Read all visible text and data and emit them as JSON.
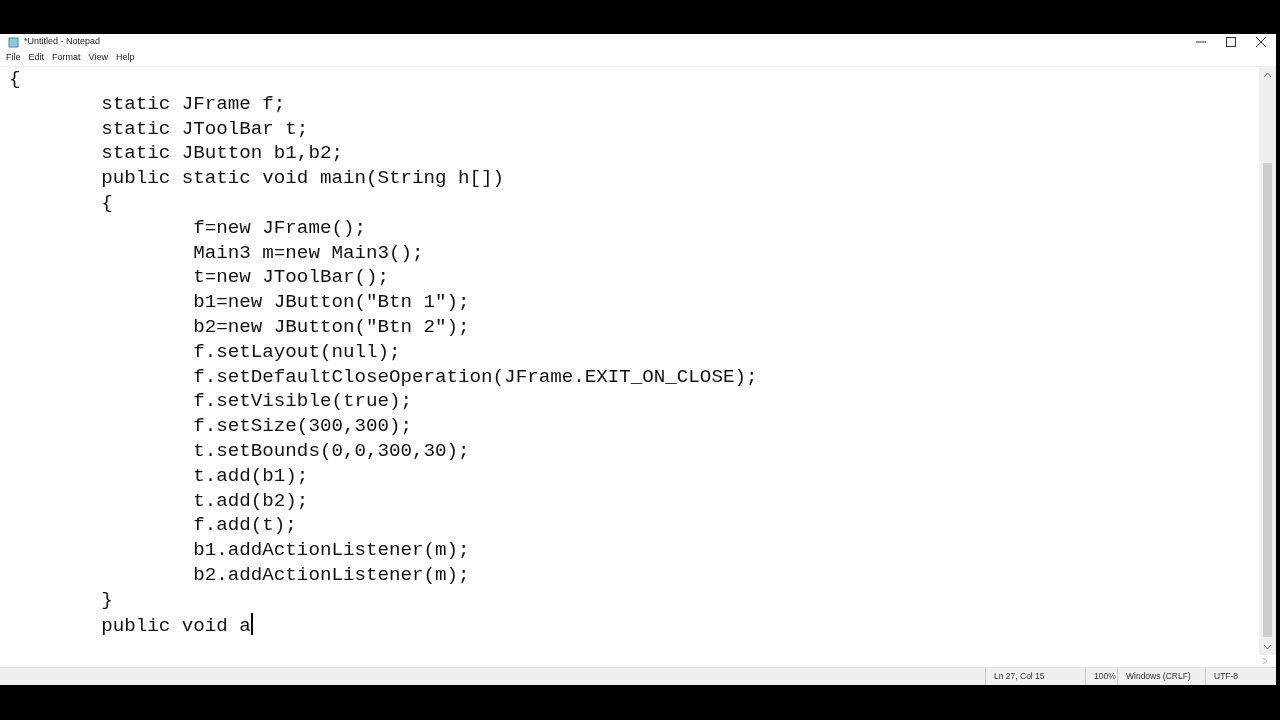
{
  "window": {
    "title": "*Untitled - Notepad"
  },
  "menu": [
    {
      "label": "File"
    },
    {
      "label": "Edit"
    },
    {
      "label": "Format"
    },
    {
      "label": "View"
    },
    {
      "label": "Help"
    }
  ],
  "editor": {
    "lines": [
      "{",
      "\tstatic JFrame f;",
      "\tstatic JToolBar t;",
      "\tstatic JButton b1,b2;",
      "\tpublic static void main(String h[])",
      "\t{",
      "\t\tf=new JFrame();",
      "\t\tMain3 m=new Main3();",
      "\t\tt=new JToolBar();",
      "\t\tb1=new JButton(\"Btn 1\");",
      "\t\tb2=new JButton(\"Btn 2\");",
      "\t\tf.setLayout(null);",
      "\t\tf.setDefaultCloseOperation(JFrame.EXIT_ON_CLOSE);",
      "\t\tf.setVisible(true);",
      "\t\tf.setSize(300,300);",
      "\t\tt.setBounds(0,0,300,30);",
      "\t\tt.add(b1);",
      "\t\tt.add(b2);",
      "\t\tf.add(t);",
      "\t\tb1.addActionListener(m);",
      "\t\tb2.addActionListener(m);",
      "\t}",
      "\tpublic void a"
    ]
  },
  "status_bar": [
    "Ln 27, Col 15",
    "100%",
    "Windows (CRLF)",
    "UTF-8"
  ]
}
